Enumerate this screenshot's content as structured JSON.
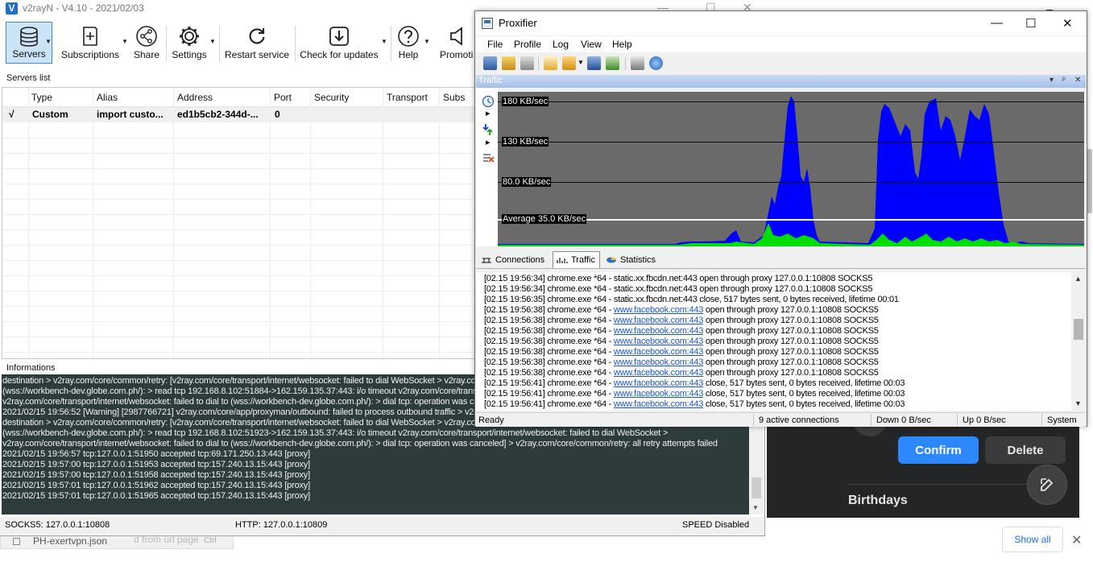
{
  "background": {
    "confirm_label": "Confirm",
    "delete_label": "Delete",
    "birthdays_label": "Birthdays",
    "show_all_label": "Show all",
    "close_label": "✕",
    "download_filename": "PH-exertvpn.json",
    "download_overlay_text": "d from url page",
    "download_extra": "Ctrl"
  },
  "v2rayn": {
    "title": "v2rayN - V4.10 - 2021/02/03",
    "toolbar": {
      "servers": "Servers",
      "subscriptions": "Subscriptions",
      "share": "Share",
      "settings": "Settings",
      "restart": "Restart service",
      "check_updates": "Check for updates",
      "help": "Help",
      "promotion": "Promotion"
    },
    "servers_list_label": "Servers list",
    "columns": [
      "Type",
      "Alias",
      "Address",
      "Port",
      "Security",
      "Transport",
      "Subs"
    ],
    "rows": [
      {
        "check": "√",
        "type": "Custom",
        "alias": "import custo...",
        "address": "ed1b5cb2-344d-...",
        "port": "0"
      }
    ],
    "informations_label": "Informations",
    "log_lines": [
      "destination > v2ray.com/core/common/retry: [v2ray.com/core/transport/internet/websocket: failed to dial WebSocket > v2ray.com/core/transport/internet/websocket: failed to dial to",
      "(wss://workbench-dev.globe.com.ph/):  > read tcp 192.168.8.102:51884->162.159.135.37:443: i/o timeout v2ray.com/core/transport/internet/websocket: failed to dial WebSocket",
      "v2ray.com/core/transport/internet/websocket: failed to dial to (wss://workbench-dev.globe.com.ph/):  > dial tcp: operation was canceled] > v2ray.com/core/common/retry: all retry attempts failed",
      "2021/02/15 19:56:52 [Warning] [2987766721] v2ray.com/core/app/proxyman/outbound: failed to process outbound traffic > v2ray.com/core/proxy/vmess/outbound: failed to find an available",
      "destination > v2ray.com/core/common/retry: [v2ray.com/core/transport/internet/websocket: failed to dial WebSocket > v2ray.com/core/transport/internet/websocket: failed to dial to",
      "(wss://workbench-dev.globe.com.ph/):  > read tcp 192.168.8.102:51923->162.159.135.37:443: i/o timeout v2ray.com/core/transport/internet/websocket: failed to dial WebSocket >",
      "v2ray.com/core/transport/internet/websocket: failed to dial to (wss://workbench-dev.globe.com.ph/):  > dial tcp: operation was canceled] > v2ray.com/core/common/retry: all retry attempts failed",
      "2021/02/15 19:56:57 tcp:127.0.0.1:51950 accepted tcp:69.171.250.13:443 [proxy]",
      "2021/02/15 19:57:00 tcp:127.0.0.1:51953 accepted tcp:157.240.13.15:443 [proxy]",
      "2021/02/15 19:57:00 tcp:127.0.0.1:51958 accepted tcp:157.240.13.15:443 [proxy]",
      "2021/02/15 19:57:01 tcp:127.0.0.1:51962 accepted tcp:157.240.13.15:443 [proxy]",
      "2021/02/15 19:57:01 tcp:127.0.0.1:51965 accepted tcp:157.240.13.15:443 [proxy]"
    ],
    "status": {
      "socks": "SOCKS5:   127.0.0.1:10808",
      "http": "HTTP:   127.0.0.1:10809",
      "speed": "SPEED Disabled"
    }
  },
  "proxifier": {
    "title": "Proxifier",
    "menu": [
      "File",
      "Profile",
      "Log",
      "View",
      "Help"
    ],
    "traffic_panel_title": "Traffic",
    "panel_buttons": [
      "▾",
      "ᵖ",
      "✕"
    ],
    "graph_labels": [
      "180 KB/sec",
      "130 KB/sec",
      "80.0 KB/sec"
    ],
    "average_label": "Average 35.0 KB/sec",
    "tabs": [
      "Connections",
      "Traffic",
      "Statistics"
    ],
    "log": [
      {
        "pre": "[02.15 19:56:34] chrome.exe *64 - static.xx.fbcdn.net:443 open through proxy 127.0.0.1:10808 SOCKS5",
        "link": "",
        "post": ""
      },
      {
        "pre": "[02.15 19:56:34] chrome.exe *64 - static.xx.fbcdn.net:443 open through proxy 127.0.0.1:10808 SOCKS5",
        "link": "",
        "post": ""
      },
      {
        "pre": "[02.15 19:56:35] chrome.exe *64 - static.xx.fbcdn.net:443 close, 517 bytes sent, 0 bytes received, lifetime 00:01",
        "link": "",
        "post": ""
      },
      {
        "pre": "[02.15 19:56:38] chrome.exe *64 - ",
        "link": "www.facebook.com:443",
        "post": " open through proxy 127.0.0.1:10808 SOCKS5"
      },
      {
        "pre": "[02.15 19:56:38] chrome.exe *64 - ",
        "link": "www.facebook.com:443",
        "post": " open through proxy 127.0.0.1:10808 SOCKS5"
      },
      {
        "pre": "[02.15 19:56:38] chrome.exe *64 - ",
        "link": "www.facebook.com:443",
        "post": " open through proxy 127.0.0.1:10808 SOCKS5"
      },
      {
        "pre": "[02.15 19:56:38] chrome.exe *64 - ",
        "link": "www.facebook.com:443",
        "post": " open through proxy 127.0.0.1:10808 SOCKS5"
      },
      {
        "pre": "[02.15 19:56:38] chrome.exe *64 - ",
        "link": "www.facebook.com:443",
        "post": " open through proxy 127.0.0.1:10808 SOCKS5"
      },
      {
        "pre": "[02.15 19:56:38] chrome.exe *64 - ",
        "link": "www.facebook.com:443",
        "post": " open through proxy 127.0.0.1:10808 SOCKS5"
      },
      {
        "pre": "[02.15 19:56:38] chrome.exe *64 - ",
        "link": "www.facebook.com:443",
        "post": " open through proxy 127.0.0.1:10808 SOCKS5"
      },
      {
        "pre": "[02.15 19:56:41] chrome.exe *64 - ",
        "link": "www.facebook.com:443",
        "post": " close, 517 bytes sent, 0 bytes received, lifetime 00:03"
      },
      {
        "pre": "[02.15 19:56:41] chrome.exe *64 - ",
        "link": "www.facebook.com:443",
        "post": " close, 517 bytes sent, 0 bytes received, lifetime 00:03"
      },
      {
        "pre": "[02.15 19:56:41] chrome.exe *64 - ",
        "link": "www.facebook.com:443",
        "post": " close, 517 bytes sent, 0 bytes received, lifetime 00:03"
      },
      {
        "pre": "[02.15 19:56:41] chrome.exe *64 - ",
        "link": "www.facebook.com:443",
        "post": " close, 517 bytes sent, 0 bytes received, lifetime 00:03"
      }
    ],
    "status": {
      "ready": "Ready",
      "connections": "9 active connections",
      "down": "Down 0 B/sec",
      "up": "Up 0 B/sec",
      "system": "System"
    },
    "colors": {
      "download": "#0000ff",
      "upload": "#00dd00",
      "graph_bg": "#6a6a6a"
    }
  }
}
